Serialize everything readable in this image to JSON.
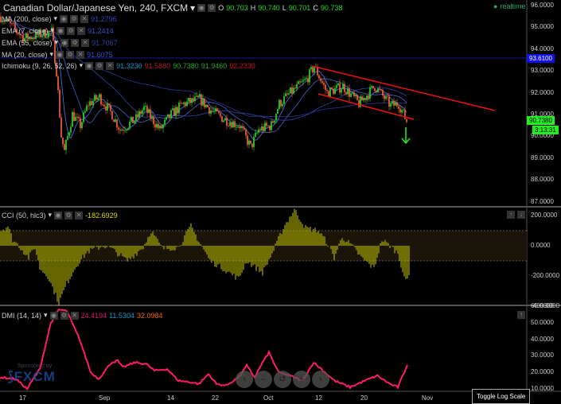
{
  "header": {
    "title": "Canadian Dollar/Japanese Yen, 240, FXCM",
    "o_label": "O",
    "o": "90.703",
    "h_label": "H",
    "h": "90.740",
    "l_label": "L",
    "l": "90.701",
    "c_label": "C",
    "c": "90.738",
    "realtime": "realtime"
  },
  "indicators": [
    {
      "name": "MA (200, close)",
      "value": "91.2796"
    },
    {
      "name": "EMA (7, close)",
      "value": "91.2414"
    },
    {
      "name": "EMA (55, close)",
      "value": "91.7067"
    },
    {
      "name": "MA (20, close)",
      "value": "91.6075"
    }
  ],
  "ichimoku": {
    "name": "Ichimoku (9, 26, 52, 26)",
    "v1": "91.3230",
    "v2": "91.5880",
    "v3": "90.7380",
    "v4": "91.9460",
    "v5": "92.2330"
  },
  "price_axis": [
    "96.0000",
    "95.0000",
    "94.0000",
    "93.0000",
    "92.0000",
    "91.0000",
    "90.0000",
    "89.0000",
    "88.0000",
    "87.0000"
  ],
  "price_tag": "93.6100",
  "last_price": "90.7380",
  "countdown": "3:13:31",
  "cci": {
    "name": "CCI (50, hlc3)",
    "value": "-182.6929",
    "axis": [
      "200.0000",
      "0.0000",
      "-200.0000",
      "-400.0000"
    ]
  },
  "dmi": {
    "name": "DMI (14, 14)",
    "v1": "24.4194",
    "v2": "11.5304",
    "v3": "32.0984",
    "axis": [
      "60.0000",
      "50.0000",
      "40.0000",
      "30.0000",
      "20.0000",
      "10.0000"
    ]
  },
  "x_axis": [
    "17",
    "Sep",
    "14",
    "22",
    "Oct",
    "12",
    "20",
    "Nov"
  ],
  "sponsor": {
    "text": "Sponsored by",
    "brand": "FXCM"
  },
  "toggle_log": "Toggle Log Scale",
  "colors": {
    "up": "#33dd33",
    "down": "#ff6644",
    "trend": "#ee1111",
    "cci": "#c8c800",
    "dmi": "#ff1a6e"
  },
  "chart_data": {
    "type": "candlestick",
    "title": "Canadian Dollar/Japanese Yen, 240, FXCM",
    "ylim": [
      87,
      96
    ],
    "price_keypoints": [
      [
        0,
        95.5
      ],
      [
        15,
        94.5
      ],
      [
        32,
        94.8
      ],
      [
        35,
        93
      ],
      [
        38,
        90
      ],
      [
        40,
        89.3
      ],
      [
        45,
        91
      ],
      [
        50,
        90.5
      ],
      [
        55,
        91.5
      ],
      [
        62,
        91.8
      ],
      [
        70,
        91
      ],
      [
        75,
        90.3
      ],
      [
        85,
        90.8
      ],
      [
        90,
        91.3
      ],
      [
        100,
        90.3
      ],
      [
        107,
        91
      ],
      [
        115,
        91.5
      ],
      [
        125,
        91.7
      ],
      [
        132,
        91.2
      ],
      [
        140,
        90.8
      ],
      [
        150,
        90.5
      ],
      [
        157,
        89.5
      ],
      [
        162,
        90.3
      ],
      [
        170,
        90.5
      ],
      [
        175,
        91.5
      ],
      [
        182,
        92
      ],
      [
        192,
        92.6
      ],
      [
        197,
        93.2
      ],
      [
        205,
        92
      ],
      [
        215,
        92.3
      ],
      [
        225,
        91.5
      ],
      [
        235,
        92.3
      ],
      [
        245,
        91.4
      ],
      [
        250,
        91.5
      ],
      [
        255,
        90.7
      ]
    ],
    "cci_keypoints": [
      [
        0,
        100
      ],
      [
        5,
        130
      ],
      [
        8,
        40
      ],
      [
        12,
        0
      ],
      [
        18,
        -80
      ],
      [
        22,
        -10
      ],
      [
        25,
        -150
      ],
      [
        30,
        -200
      ],
      [
        37,
        -380
      ],
      [
        42,
        -250
      ],
      [
        48,
        -130
      ],
      [
        55,
        -40
      ],
      [
        65,
        0
      ],
      [
        70,
        -20
      ],
      [
        80,
        -100
      ],
      [
        90,
        -10
      ],
      [
        95,
        100
      ],
      [
        102,
        -20
      ],
      [
        112,
        -10
      ],
      [
        120,
        130
      ],
      [
        125,
        30
      ],
      [
        132,
        -100
      ],
      [
        140,
        -150
      ],
      [
        150,
        -220
      ],
      [
        155,
        -100
      ],
      [
        165,
        -180
      ],
      [
        172,
        -30
      ],
      [
        178,
        120
      ],
      [
        185,
        240
      ],
      [
        192,
        120
      ],
      [
        200,
        100
      ],
      [
        205,
        30
      ],
      [
        210,
        -80
      ],
      [
        215,
        60
      ],
      [
        222,
        -10
      ],
      [
        227,
        -80
      ],
      [
        235,
        -150
      ],
      [
        240,
        40
      ],
      [
        245,
        0
      ],
      [
        250,
        -50
      ],
      [
        255,
        -240
      ],
      [
        257,
        -200
      ]
    ],
    "cci_ylim": [
      -400,
      220
    ],
    "dmi_keypoints": [
      [
        0,
        17
      ],
      [
        10,
        16
      ],
      [
        17,
        10
      ],
      [
        25,
        22
      ],
      [
        32,
        50
      ],
      [
        37,
        58
      ],
      [
        42,
        57
      ],
      [
        50,
        40
      ],
      [
        57,
        20
      ],
      [
        62,
        16
      ],
      [
        70,
        26
      ],
      [
        74,
        27
      ],
      [
        77,
        23
      ],
      [
        85,
        26
      ],
      [
        92,
        25
      ],
      [
        97,
        21
      ],
      [
        105,
        22
      ],
      [
        112,
        15
      ],
      [
        120,
        14
      ],
      [
        125,
        13
      ],
      [
        131,
        19
      ],
      [
        136,
        13
      ],
      [
        142,
        12
      ],
      [
        150,
        17
      ],
      [
        155,
        24
      ],
      [
        160,
        17
      ],
      [
        165,
        26
      ],
      [
        169,
        32
      ],
      [
        175,
        20
      ],
      [
        182,
        18
      ],
      [
        190,
        15
      ],
      [
        197,
        26
      ],
      [
        202,
        22
      ],
      [
        210,
        15
      ],
      [
        220,
        11
      ],
      [
        227,
        14
      ],
      [
        237,
        18
      ],
      [
        245,
        13
      ],
      [
        250,
        11
      ],
      [
        254,
        20
      ],
      [
        256,
        25
      ]
    ],
    "dmi_ylim": [
      5,
      60
    ]
  }
}
